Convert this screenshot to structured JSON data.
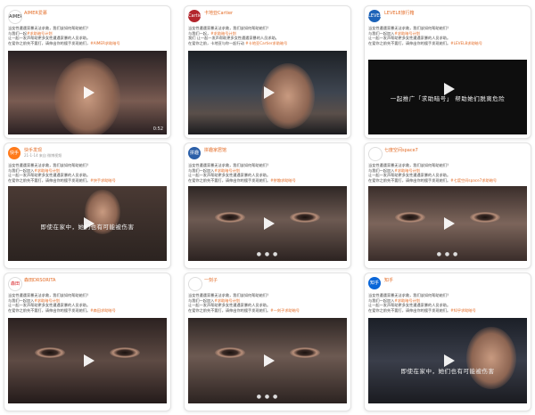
{
  "cards": [
    {
      "user": "AIMER爱慕",
      "meta": "",
      "avatar_text": "AIMER",
      "avatar_color": "#ffffff",
      "follow": "",
      "lines": [
        {
          "text": "当女性遭遇家暴无法求救，我们该如何帮助她们？",
          "tag": ""
        },
        {
          "text": "与我们一起",
          "tag": "#求助暗号计划"
        },
        {
          "text": "让一起一发声帮助更多女性遭遇家暴的人员求助。",
          "tag": ""
        },
        {
          "text": "在爱你之前先不要打，请伸出你的援手发现她们，",
          "tag": "#AIMER求助暗号"
        }
      ],
      "caption": "",
      "duration": "0:52"
    },
    {
      "user": "卡地亚Cartier",
      "meta": "",
      "avatar_text": "Cartier",
      "avatar_color": "#b3262d",
      "follow": "",
      "lines": [
        {
          "text": "当女性遭遇家暴无法求救，我们该如何帮助她们？",
          "tag": ""
        },
        {
          "text": "与我们一起，",
          "tag": "#求助暗号计划"
        },
        {
          "text": "我们 让一起一发声帮助更多女性遭遇家暴的人员求助。",
          "tag": ""
        },
        {
          "text": "在爱你之前，卡地亚与你一起行动 ",
          "tag": "#卡地亚Cartier求助暗号"
        }
      ],
      "caption": "",
      "duration": ""
    },
    {
      "user": "LEVEL8旅行箱",
      "meta": "",
      "avatar_text": "LEVEL8",
      "avatar_color": "#1d63b8",
      "follow": "",
      "lines": [
        {
          "text": "当女性遭遇家暴无法求救，我们该如何帮助她们？",
          "tag": ""
        },
        {
          "text": "与我们一起加入",
          "tag": "#求助暗号计划"
        },
        {
          "text": "让一起一发声帮助更多女性遭遇家暴的人员求助。",
          "tag": ""
        },
        {
          "text": "在爱你之前先不要打，请伸出你的援手发现她们。",
          "tag": "#LEVEL8求助暗号"
        }
      ],
      "caption": "一起推广「求助暗号」 帮助她们脱离危险",
      "duration": ""
    },
    {
      "user": "快手发现",
      "meta": "21-1-14 来自 微博视频",
      "avatar_text": "快手",
      "avatar_color": "#ff7a1a",
      "follow": "",
      "lines": [
        {
          "text": "当女性遭遇家暴无法求救，我们该如何帮助她们？",
          "tag": ""
        },
        {
          "text": "与我们一起加入",
          "tag": "#求助暗号计划"
        },
        {
          "text": "让一起一发声帮助更多女性遭遇家暴的人员求助。",
          "tag": ""
        },
        {
          "text": "在爱你之前先不要打，请伸出你的援手发现她们。",
          "tag": "#快手求助暗号"
        }
      ],
      "caption": "即使在家中，她们也有可能被伤害",
      "duration": ""
    },
    {
      "user": "拼趣家居馆",
      "meta": "",
      "avatar_text": "拼趣",
      "avatar_color": "#2b5fa8",
      "follow": "",
      "lines": [
        {
          "text": "当女性遭遇家暴无法求救，我们该如何帮助她们？",
          "tag": ""
        },
        {
          "text": "与我们一起加入",
          "tag": "#求助暗号计划"
        },
        {
          "text": "让一起一发声帮助更多女性遭遇家暴的人员求助。",
          "tag": ""
        },
        {
          "text": "在爱你之前先不要打，请伸出你的援手发现她们。",
          "tag": "#拼趣求助暗号"
        }
      ],
      "caption": "",
      "duration": ""
    },
    {
      "user": "七度空间space7",
      "meta": "",
      "avatar_text": "",
      "avatar_color": "#ffffff",
      "follow": "",
      "lines": [
        {
          "text": "当女性遭遇家暴无法求救，我们该如何帮助她们？",
          "tag": ""
        },
        {
          "text": "与我们一起加入",
          "tag": "#求助暗号计划"
        },
        {
          "text": "让一起一发声帮助更多女性遭遇家暴的人员求助。",
          "tag": ""
        },
        {
          "text": "在爱你之前先不要打，请伸出你的援手发现她们。",
          "tag": "#七度空间space7求助暗号"
        }
      ],
      "caption": "",
      "duration": ""
    },
    {
      "user": "森田DRSORITA",
      "meta": "",
      "avatar_text": "森田",
      "avatar_color": "#ffffff",
      "follow": "",
      "lines": [
        {
          "text": "当女性遭遇家暴无法求救，我们该如何帮助她们？",
          "tag": ""
        },
        {
          "text": "与我们一起加入",
          "tag": "#求助暗号计划"
        },
        {
          "text": "让一起一发声帮助更多女性遭遇家暴的人员求助。",
          "tag": ""
        },
        {
          "text": "在爱你之前先不要打，请伸出你的援手发现她们。",
          "tag": "#森田求助暗号"
        }
      ],
      "caption": "",
      "duration": ""
    },
    {
      "user": "一刻子",
      "meta": "",
      "avatar_text": "",
      "avatar_color": "#ffffff",
      "follow": "",
      "lines": [
        {
          "text": "当女性遭遇家暴无法求救，我们该如何帮助她们？",
          "tag": ""
        },
        {
          "text": "与我们一起加入",
          "tag": "#求助暗号计划"
        },
        {
          "text": "让一起一发声帮助更多女性遭遇家暴的人员求助。",
          "tag": ""
        },
        {
          "text": "在爱你之前先不要打，请伸出你的援手发现她们。",
          "tag": "#一刻子求助暗号"
        }
      ],
      "caption": "",
      "duration": ""
    },
    {
      "user": "知乎",
      "meta": "",
      "avatar_text": "知乎",
      "avatar_color": "#0a66d8",
      "follow": "",
      "lines": [
        {
          "text": "当女性遭遇家暴无法求救，我们该如何帮助她们？",
          "tag": ""
        },
        {
          "text": "与我们一起加入",
          "tag": "#求助暗号计划"
        },
        {
          "text": "让一起一发声帮助更多女性遭遇家暴的人员求助。",
          "tag": ""
        },
        {
          "text": "在爱你之前先不要打，请伸出你的援手发现她们。",
          "tag": "#知乎求助暗号"
        }
      ],
      "caption": "即使在家中，她们也有可能被伤害",
      "duration": ""
    }
  ]
}
